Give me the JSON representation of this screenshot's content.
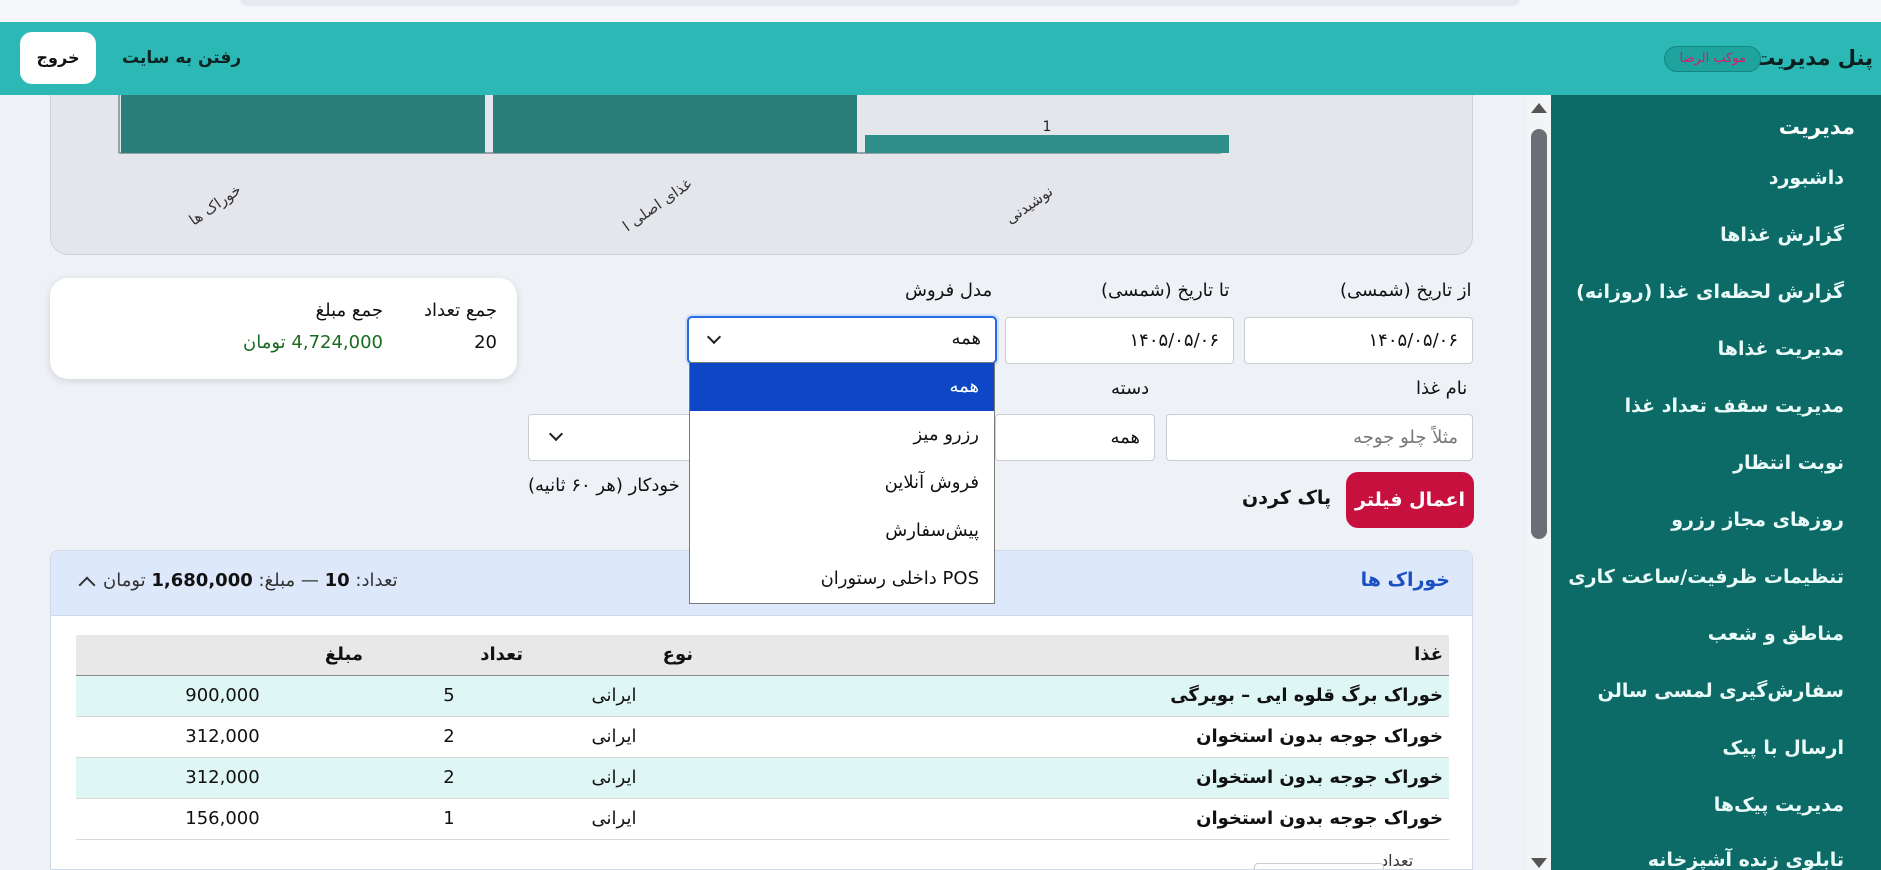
{
  "header": {
    "brand": "پنل مدیریت",
    "badge": "موکب الرضا",
    "site_link": "رفتن به سایت",
    "logout": "خروج"
  },
  "sidebar": {
    "heading": "مدیریت",
    "items": [
      {
        "label": "داشبورد"
      },
      {
        "label": "گزارش غذاها"
      },
      {
        "label": "گزارش لحظه‌ای غذا (روزانه)"
      },
      {
        "label": "مدیریت غذاها"
      },
      {
        "label": "مدیریت سقف تعداد غذا"
      },
      {
        "label": "نوبت انتظار"
      },
      {
        "label": "روزهای مجاز رزرو"
      },
      {
        "label": "تنظیمات ظرفیت/ساعت کاری"
      },
      {
        "label": "مناطق و شعب"
      },
      {
        "label": "سفارش‌گیری لمسی سالن"
      },
      {
        "label": "ارسال با پیک"
      },
      {
        "label": "مدیریت پیک‌ها"
      },
      {
        "label": "تابلوی زنده آشپزخانه"
      }
    ]
  },
  "chart_data": {
    "type": "bar",
    "categories": [
      "خوراک ها",
      "غذای اصلی ا",
      "نوشیدنی"
    ],
    "values": [
      null,
      null,
      1
    ],
    "data_labels": [
      "",
      "",
      "1"
    ],
    "colors": {
      "bar": "#2a7f7c",
      "card": "#e4e6ec"
    }
  },
  "summary": {
    "count_label": "جمع تعداد",
    "amount_label": "جمع مبلغ",
    "count": "20",
    "amount": "4,724,000 تومان"
  },
  "filters": {
    "from_date_label": "از تاریخ (شمسی)",
    "from_date": "۱۴۰۵/۰۵/۰۶",
    "to_date_label": "تا تاریخ (شمسی)",
    "to_date": "۱۴۰۵/۰۵/۰۶",
    "sale_model_label": "مدل فروش",
    "sale_model_value": "همه",
    "sale_model_options": [
      "همه",
      "رزرو میز",
      "فروش آنلاین",
      "پیش‌سفارش",
      "POS داخلی رستوران"
    ],
    "food_name_label": "نام غذا",
    "food_name_placeholder": "مثلاً چلو جوجه",
    "category_label": "دسته",
    "category_value": "همه",
    "auto_refresh": "خودکار (هر ۶۰ ثانیه)",
    "apply": "اعمال فیلتر",
    "clear": "پاک کردن"
  },
  "section": {
    "title": "خوراک ها",
    "stats_prefix": "تعداد:",
    "stats_count": "10",
    "stats_mid": "— مبلغ:",
    "stats_amount": "1,680,000",
    "stats_suffix": "تومان",
    "columns": {
      "name": "غذا",
      "type": "نوع",
      "qty": "تعداد",
      "amount": "مبلغ"
    },
    "rows": [
      {
        "name": "خوراک برگ قلوه ایی – بویرگی",
        "type": "ایرانی",
        "qty": "5",
        "amount": "900,000"
      },
      {
        "name": "خوراک جوجه بدون استخوان",
        "type": "ایرانی",
        "qty": "2",
        "amount": "312,000"
      },
      {
        "name": "خوراک جوجه بدون استخوان",
        "type": "ایرانی",
        "qty": "2",
        "amount": "312,000"
      },
      {
        "name": "خوراک جوجه بدون استخوان",
        "type": "ایرانی",
        "qty": "1",
        "amount": "156,000"
      }
    ],
    "pager_label": "تعداد"
  },
  "colors": {
    "topbar": "#2cb8b4",
    "sidebar": "#0c6b67",
    "apply_button": "#c8103e",
    "dropdown_active": "#0d47c5",
    "row_alt": "#dff7f4",
    "amount_green": "#1a6b22"
  }
}
